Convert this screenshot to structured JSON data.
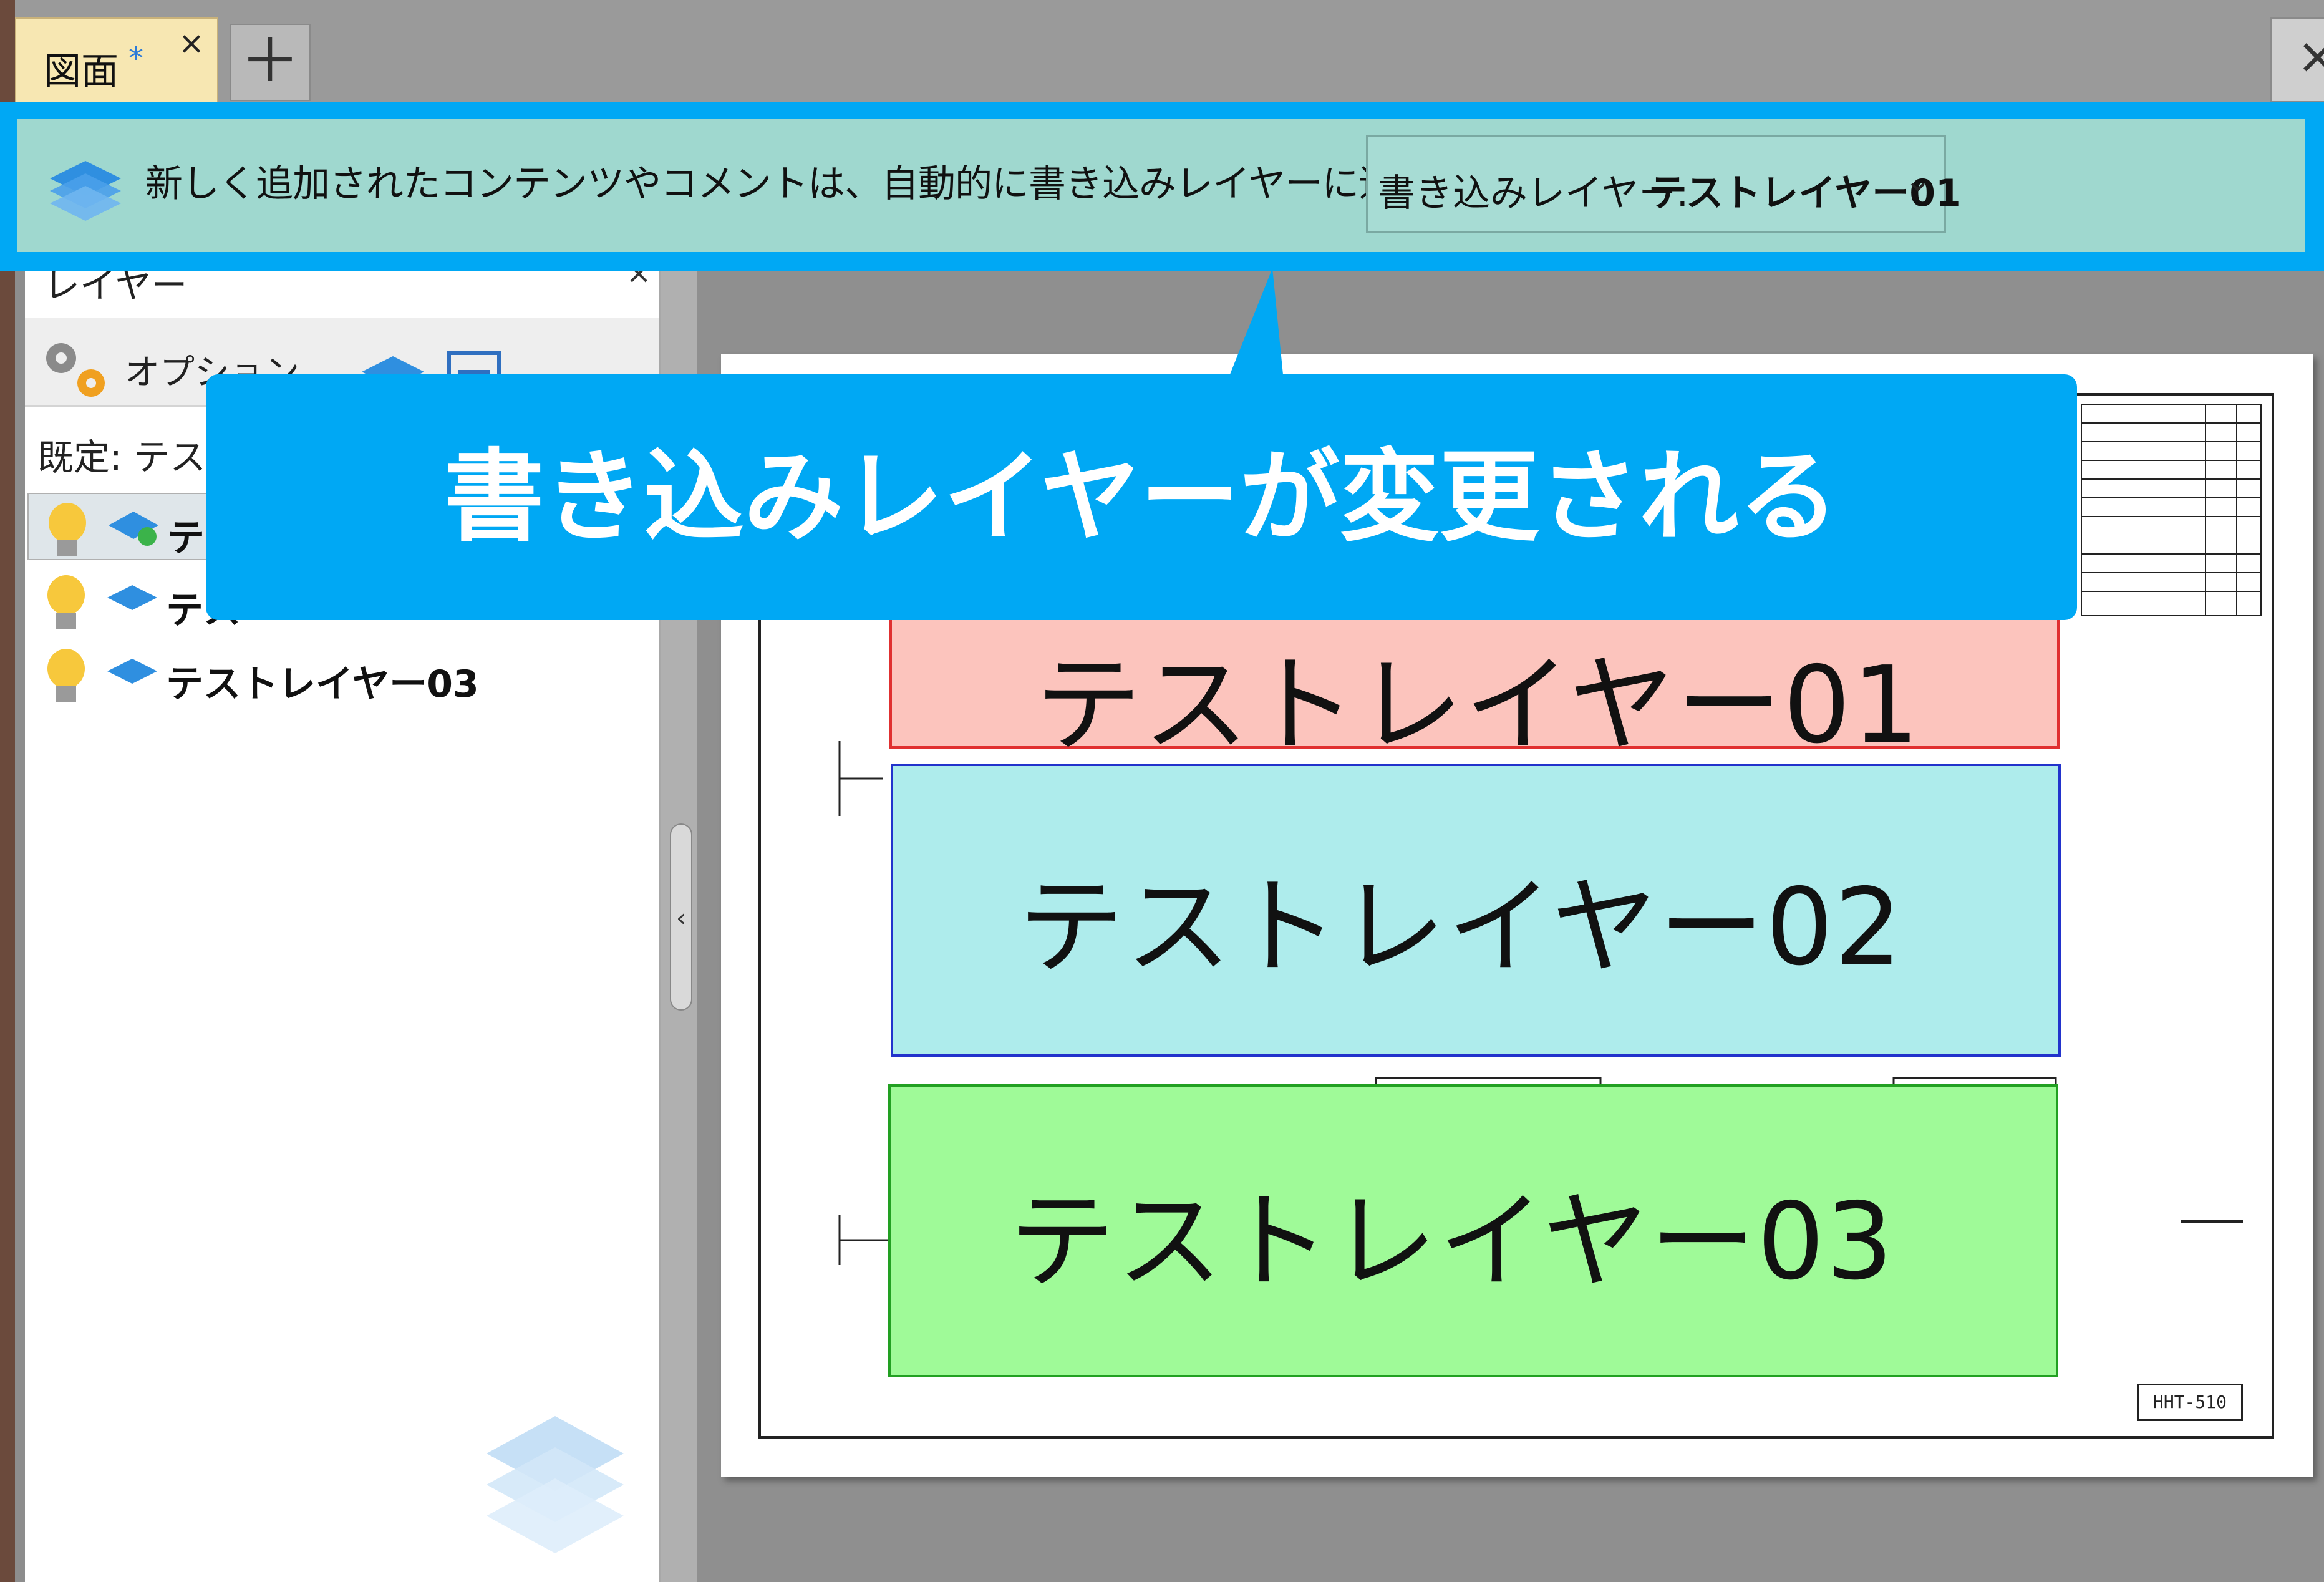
{
  "tabs": [
    {
      "label": "図面",
      "modified_marker": "*",
      "close": "×"
    }
  ],
  "new_tab_label": "＋",
  "window_close_label": "×",
  "notification": {
    "message": "新しく追加されたコンテンツやコメントは、自動的に書き込みレイヤーに追加されます",
    "layer_select": {
      "prefix": "書き込みレイヤー:",
      "value": "テストレイヤー01"
    }
  },
  "panel": {
    "title": "レイヤー",
    "close": "×",
    "options_label": "オプション...",
    "default_label": "既定: テスト",
    "layers": [
      {
        "label": "テ",
        "selected": true,
        "active": true
      },
      {
        "label": "テス",
        "selected": false,
        "active": false
      },
      {
        "label": "テストレイヤー03",
        "selected": false,
        "active": false
      }
    ]
  },
  "drawing": {
    "layers": [
      {
        "label": "テストレイヤー01",
        "color": "#fcc4bd"
      },
      {
        "label": "テストレイヤー02",
        "color": "#aeecec"
      },
      {
        "label": "テストレイヤー03",
        "color": "#9ffa98"
      }
    ],
    "title_block": "HHT-510"
  },
  "callout": {
    "text": "書き込みレイヤーが変更される",
    "color": "#00a8f4"
  },
  "colors": {
    "accent": "#00a8f4",
    "notify_bg": "#9fd8cf",
    "tab_bg": "#f7e7b2"
  }
}
